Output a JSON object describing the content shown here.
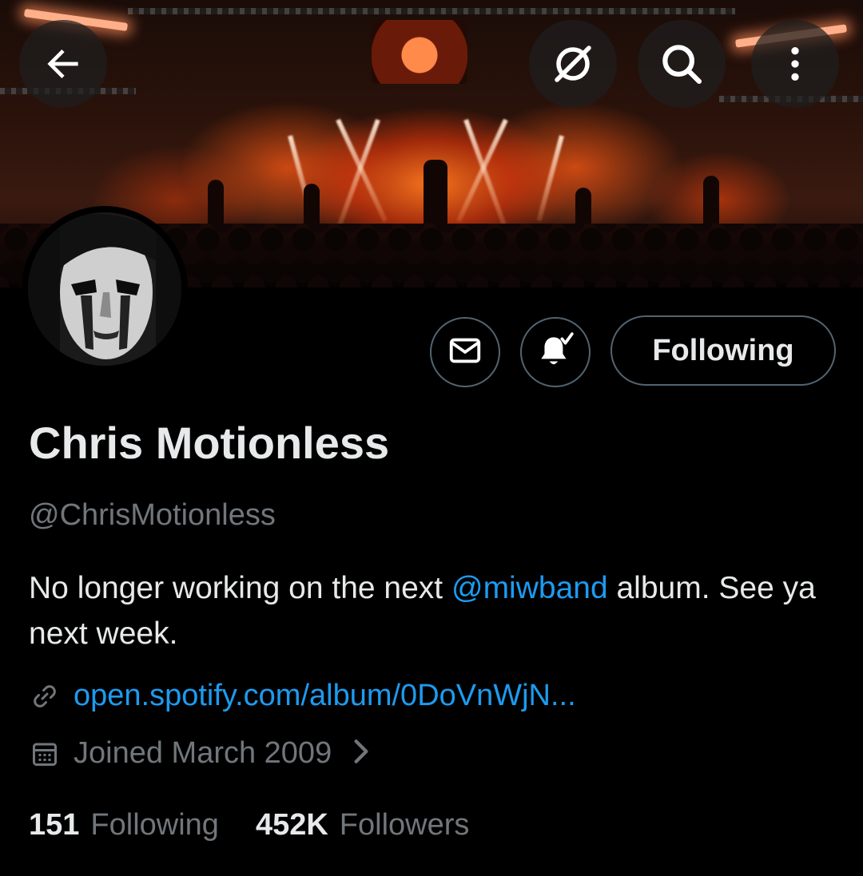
{
  "topbar": {
    "back_icon": "arrow-left-icon",
    "grok_icon": "grok-icon",
    "search_icon": "search-icon",
    "more_icon": "more-vertical-icon"
  },
  "banner": {
    "description_icon": "concert-stage-banner"
  },
  "actions": {
    "message_icon": "envelope-icon",
    "notifications_icon": "bell-check-icon",
    "following_label": "Following"
  },
  "profile": {
    "display_name": "Chris Motionless",
    "handle": "@ChrisMotionless",
    "bio_before": "No longer working on the next ",
    "bio_mention": "@miwband",
    "bio_after": " album. See ya next week.",
    "link_text": "open.spotify.com/album/0DoVnWjN...",
    "joined_text": "Joined March 2009"
  },
  "stats": {
    "following_count": "151",
    "following_label": "Following",
    "followers_count": "452K",
    "followers_label": "Followers"
  },
  "colors": {
    "background": "#000000",
    "text": "#e7e9ea",
    "muted": "#71767b",
    "accent": "#1d9bf0",
    "border": "#536471"
  }
}
